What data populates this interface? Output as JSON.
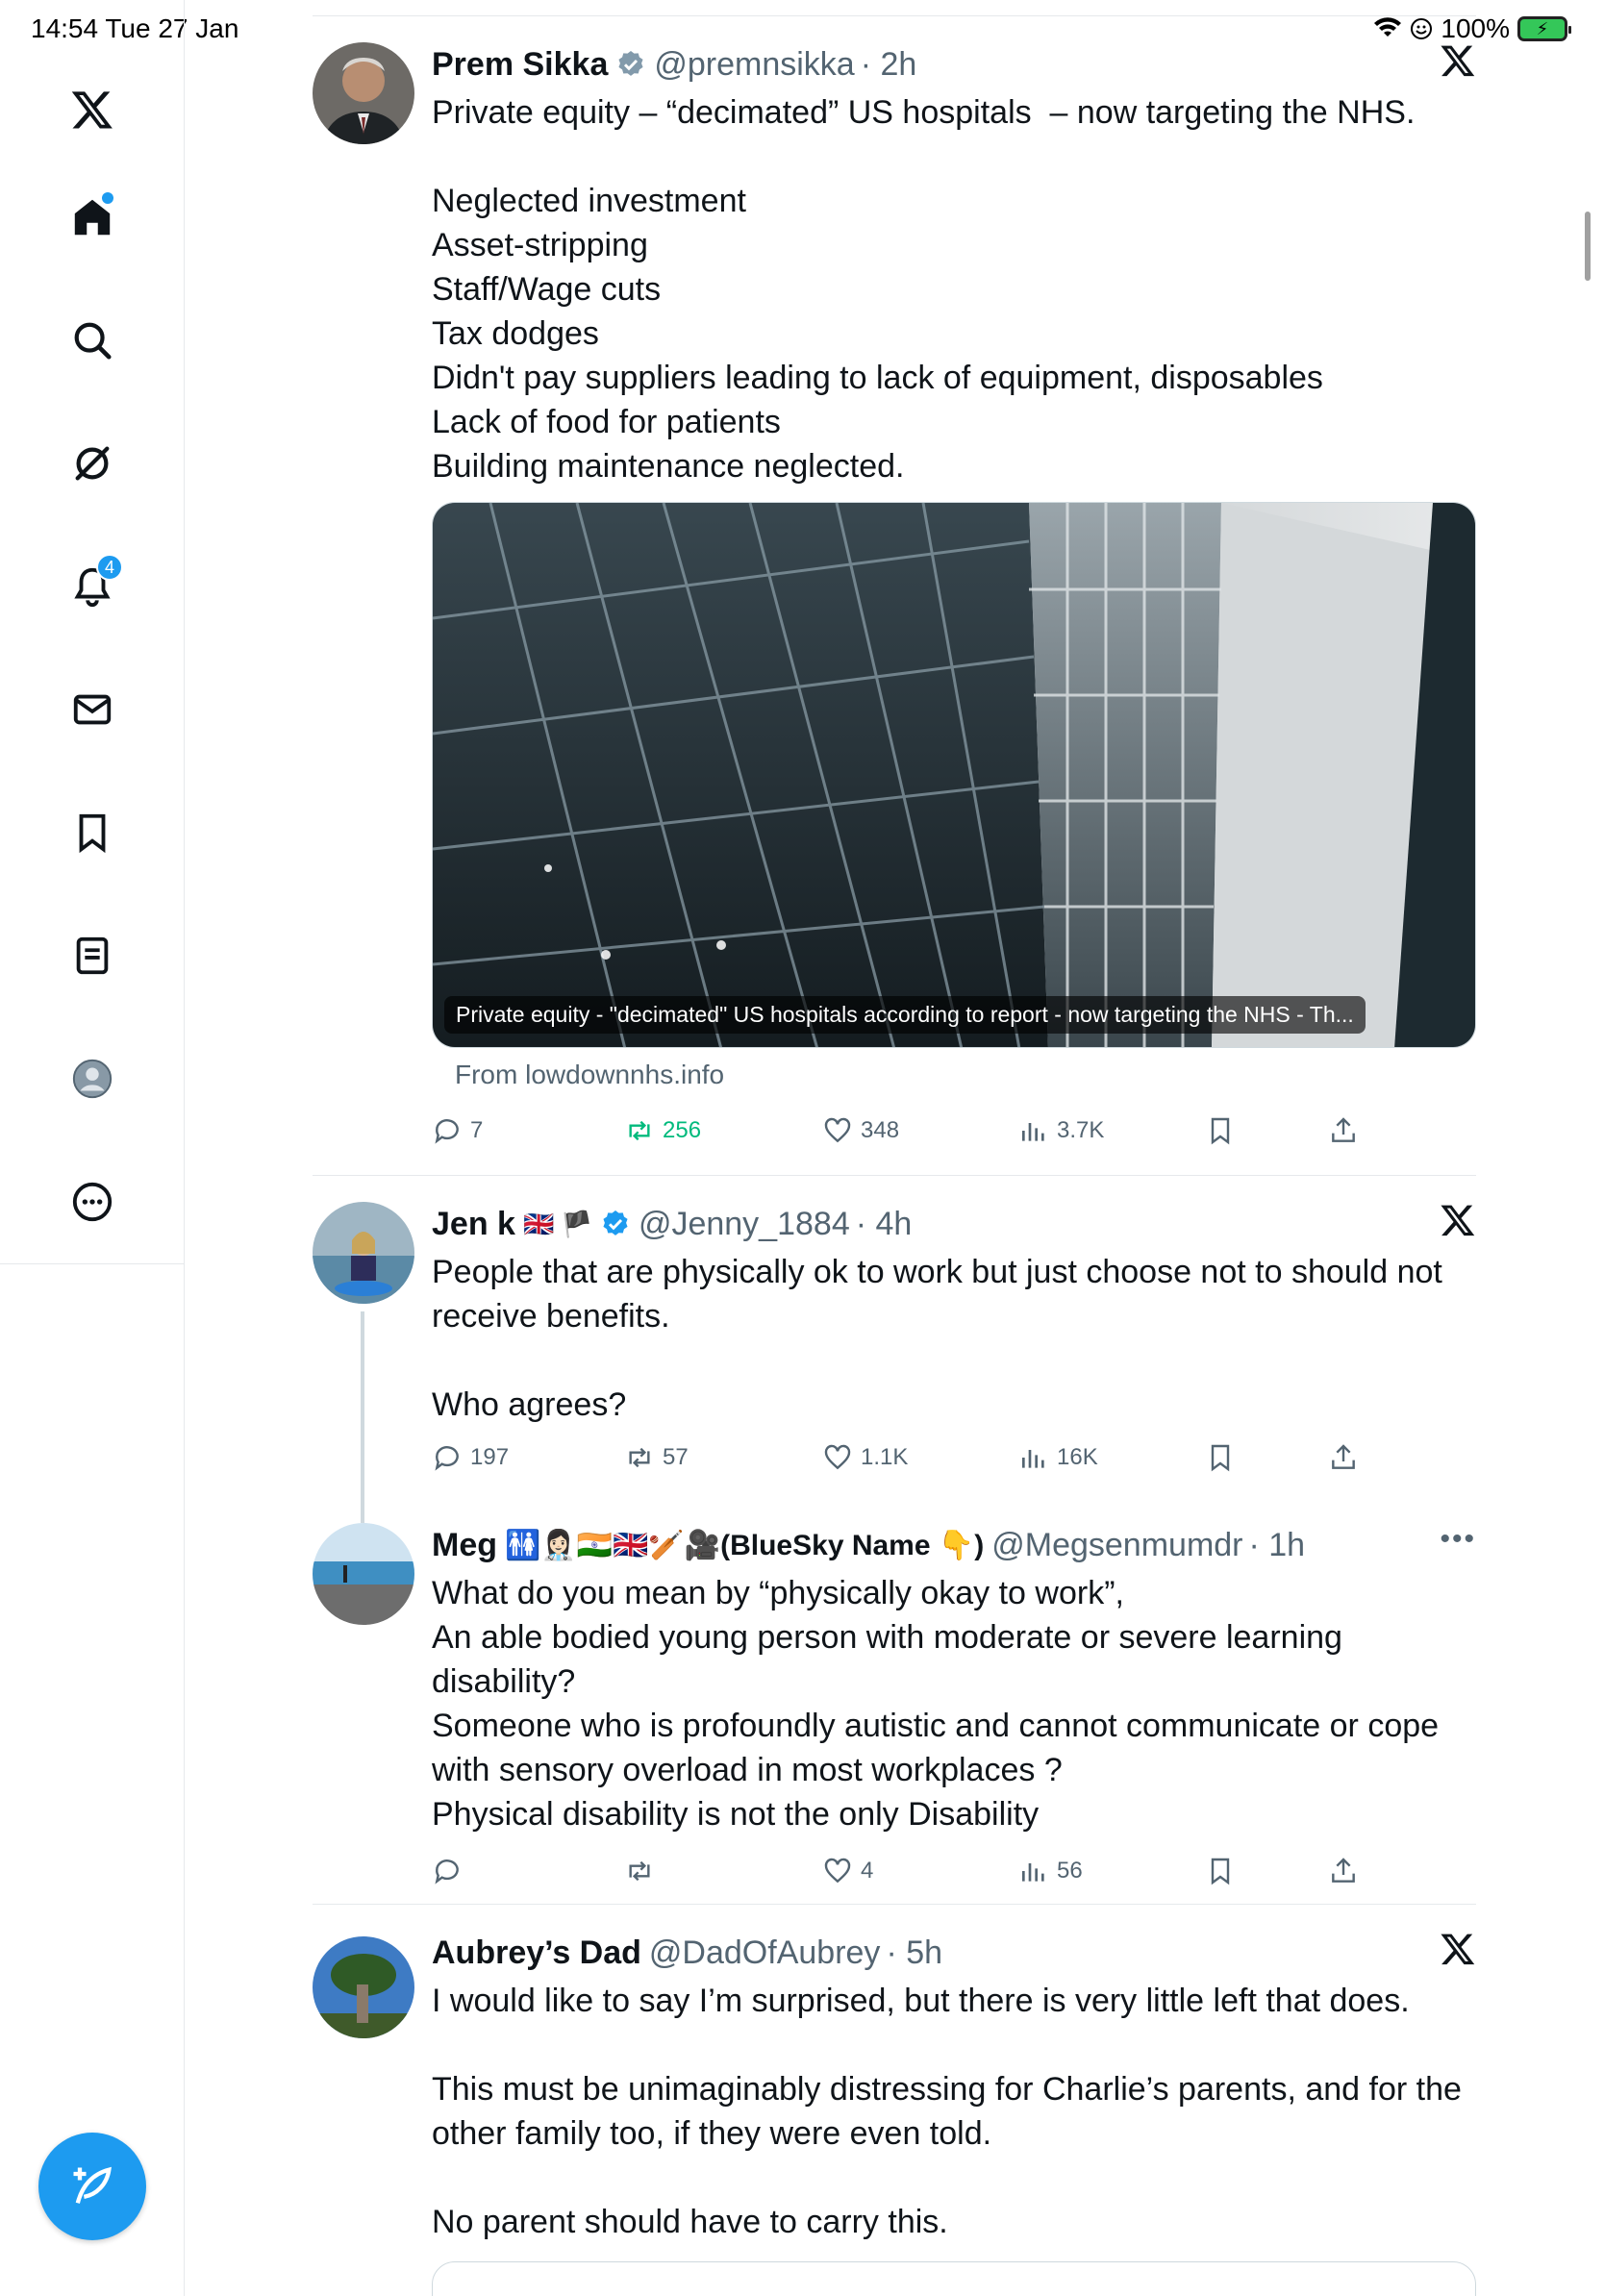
{
  "status_bar": {
    "time_date": "14:54  Tue 27 Jan",
    "battery": "100%"
  },
  "sidebar": {
    "notifications_count": "4",
    "items": [
      "x-logo",
      "home",
      "search",
      "grok",
      "notifications",
      "messages",
      "bookmarks",
      "lists",
      "profile",
      "more"
    ]
  },
  "posts": [
    {
      "name": "Prem Sikka",
      "handle": "@premnsikka",
      "time": "· 2h",
      "verified": true,
      "text": "Private equity – “decimated” US hospitals  – now targeting the NHS.\n\nNeglected investment\nAsset-stripping\nStaff/Wage cuts\nTax dodges\nDidn't pay suppliers leading to lack of equipment, disposables\nLack of food for patients\nBuilding maintenance neglected.",
      "card_caption": "Private equity - \"decimated\" US hospitals according to report - now targeting the NHS - Th...",
      "card_source": "From lowdownnhs.info",
      "replies": "7",
      "reposts": "256",
      "likes": "348",
      "views": "3.7K"
    },
    {
      "name": "Jen k",
      "flags": "🇬🇧 🏴",
      "handle": "@Jenny_1884",
      "time": "· 4h",
      "verified": true,
      "text": "People that are physically ok to work but just choose not to should not receive benefits.\n\nWho agrees?",
      "replies": "197",
      "reposts": "57",
      "likes": "1.1K",
      "views": "16K"
    },
    {
      "name": "Meg",
      "flags": "🚻👩🏻‍⚕️🇮🇳🇬🇧🏏🎥(BlueSky Name 👇)",
      "handle": "@Megsenmumdr",
      "time": "· 1h",
      "verified": false,
      "text": "What do you mean by “physically okay to work”,\nAn able bodied young person with moderate or severe learning disability?\nSomeone who is profoundly autistic and cannot communicate or cope with sensory overload in most workplaces ?\nPhysical disability is not the only Disability",
      "replies": "",
      "reposts": "",
      "likes": "4",
      "views": "56"
    },
    {
      "name": "Aubrey’s Dad",
      "handle": "@DadOfAubrey",
      "time": "· 5h",
      "verified": false,
      "text": "I would like to say I’m surprised, but there is very little left that does.\n\nThis must be unimaginably distressing for Charlie’s parents, and for the other family too, if they were even told.\n\nNo parent should have to carry this."
    }
  ],
  "colors": {
    "accent": "#1d9bf0",
    "repost_active": "#00ba7c",
    "secondary_text": "#536471"
  }
}
